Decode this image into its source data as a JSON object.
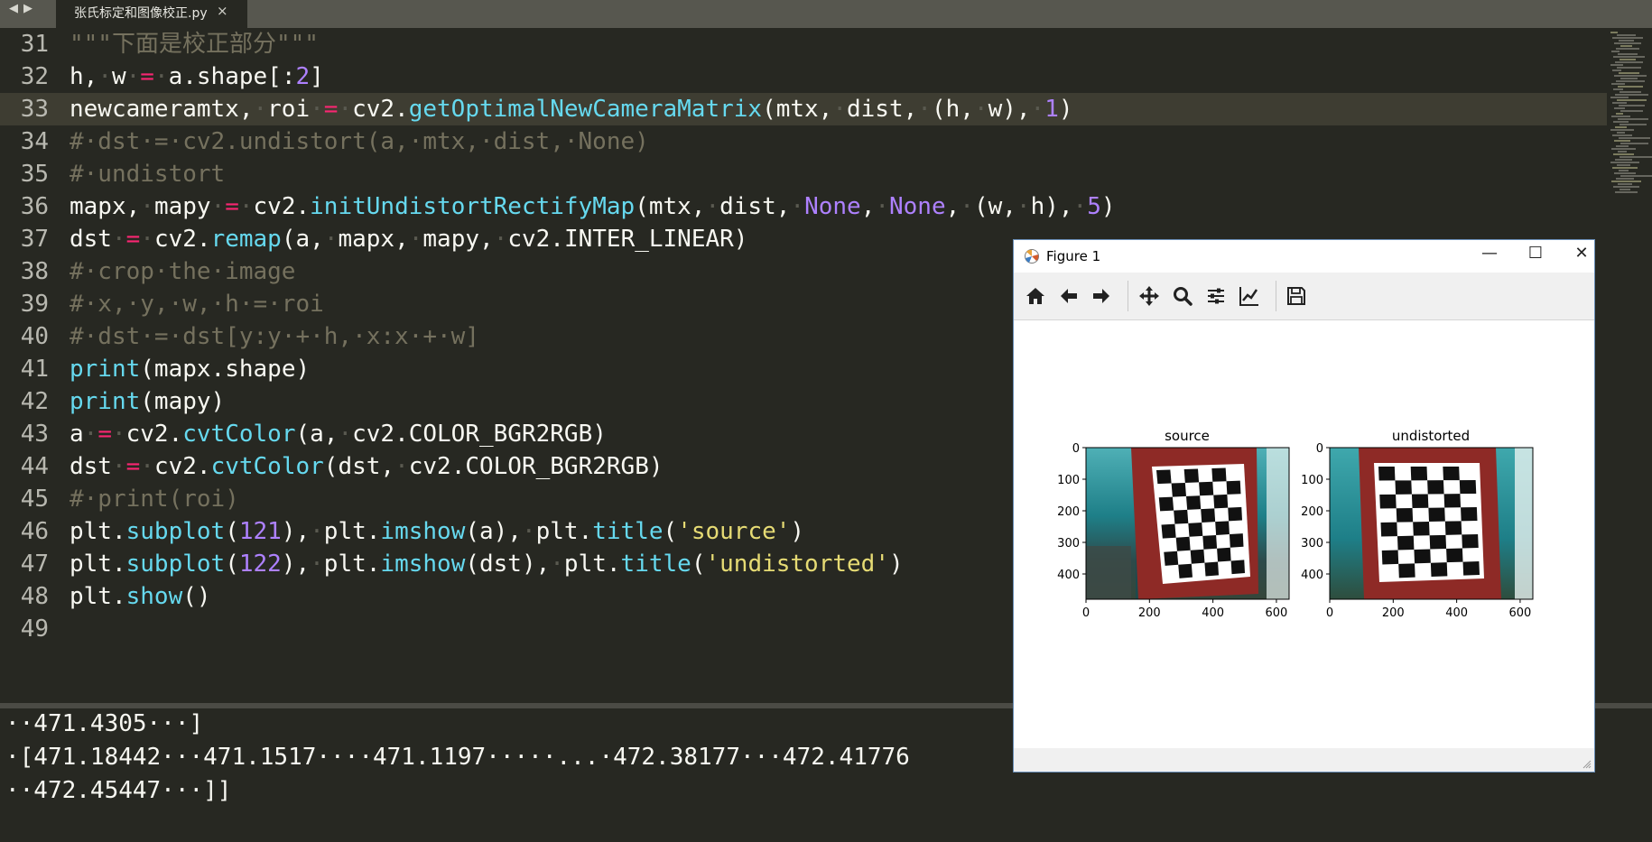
{
  "tab": {
    "title": "张氏标定和图像校正.py",
    "close": "×"
  },
  "lines": [
    {
      "num": "31",
      "tokens": [
        {
          "t": "\"\"\"下面是校正部分\"\"\"",
          "c": "c"
        }
      ]
    },
    {
      "num": "32",
      "tokens": [
        {
          "t": "h,"
        },
        {
          "t": "·",
          "c": "w"
        },
        {
          "t": "w"
        },
        {
          "t": "·",
          "c": "w"
        },
        {
          "t": "=",
          "c": "k"
        },
        {
          "t": "·",
          "c": "w"
        },
        {
          "t": "a.shape[:"
        },
        {
          "t": "2",
          "c": "n"
        },
        {
          "t": "]"
        }
      ]
    },
    {
      "num": "33",
      "current": true,
      "tokens": [
        {
          "t": "newcameramtx,"
        },
        {
          "t": "·",
          "c": "w"
        },
        {
          "t": "roi"
        },
        {
          "t": "·",
          "c": "w"
        },
        {
          "t": "=",
          "c": "k"
        },
        {
          "t": "·",
          "c": "w"
        },
        {
          "t": "cv2."
        },
        {
          "t": "getOptimalNewCameraMatrix",
          "c": "f"
        },
        {
          "t": "(mtx,"
        },
        {
          "t": "·",
          "c": "w"
        },
        {
          "t": "dist,"
        },
        {
          "t": "·",
          "c": "w"
        },
        {
          "t": "(h,"
        },
        {
          "t": "·",
          "c": "w"
        },
        {
          "t": "w),"
        },
        {
          "t": "·",
          "c": "w"
        },
        {
          "t": "1",
          "c": "n"
        },
        {
          "t": ")"
        }
      ]
    },
    {
      "num": "34",
      "tokens": [
        {
          "t": "#·dst·=·cv2.undistort(a,·mtx,·dist,·None)",
          "c": "c"
        }
      ]
    },
    {
      "num": "35",
      "tokens": [
        {
          "t": "#·undistort",
          "c": "c"
        }
      ]
    },
    {
      "num": "36",
      "tokens": [
        {
          "t": "mapx,"
        },
        {
          "t": "·",
          "c": "w"
        },
        {
          "t": "mapy"
        },
        {
          "t": "·",
          "c": "w"
        },
        {
          "t": "=",
          "c": "k"
        },
        {
          "t": "·",
          "c": "w"
        },
        {
          "t": "cv2."
        },
        {
          "t": "initUndistortRectifyMap",
          "c": "f"
        },
        {
          "t": "(mtx,"
        },
        {
          "t": "·",
          "c": "w"
        },
        {
          "t": "dist,"
        },
        {
          "t": "·",
          "c": "w"
        },
        {
          "t": "None",
          "c": "n"
        },
        {
          "t": ","
        },
        {
          "t": "·",
          "c": "w"
        },
        {
          "t": "None",
          "c": "n"
        },
        {
          "t": ","
        },
        {
          "t": "·",
          "c": "w"
        },
        {
          "t": "(w,"
        },
        {
          "t": "·",
          "c": "w"
        },
        {
          "t": "h),"
        },
        {
          "t": "·",
          "c": "w"
        },
        {
          "t": "5",
          "c": "n"
        },
        {
          "t": ")"
        }
      ]
    },
    {
      "num": "37",
      "tokens": [
        {
          "t": "dst"
        },
        {
          "t": "·",
          "c": "w"
        },
        {
          "t": "=",
          "c": "k"
        },
        {
          "t": "·",
          "c": "w"
        },
        {
          "t": "cv2."
        },
        {
          "t": "remap",
          "c": "f"
        },
        {
          "t": "(a,"
        },
        {
          "t": "·",
          "c": "w"
        },
        {
          "t": "mapx,"
        },
        {
          "t": "·",
          "c": "w"
        },
        {
          "t": "mapy,"
        },
        {
          "t": "·",
          "c": "w"
        },
        {
          "t": "cv2.INTER_LINEAR)"
        }
      ]
    },
    {
      "num": "38",
      "tokens": [
        {
          "t": "#·crop·the·image",
          "c": "c"
        }
      ]
    },
    {
      "num": "39",
      "tokens": [
        {
          "t": "#·x,·y,·w,·h·=·roi",
          "c": "c"
        }
      ]
    },
    {
      "num": "40",
      "tokens": [
        {
          "t": "#·dst·=·dst[y:y·+·h,·x:x·+·w]",
          "c": "c"
        }
      ]
    },
    {
      "num": "41",
      "tokens": [
        {
          "t": "print",
          "c": "f"
        },
        {
          "t": "(mapx.shape)"
        }
      ]
    },
    {
      "num": "42",
      "tokens": [
        {
          "t": "print",
          "c": "f"
        },
        {
          "t": "(mapy)"
        }
      ]
    },
    {
      "num": "43",
      "tokens": [
        {
          "t": "a"
        },
        {
          "t": "·",
          "c": "w"
        },
        {
          "t": "=",
          "c": "k"
        },
        {
          "t": "·",
          "c": "w"
        },
        {
          "t": "cv2."
        },
        {
          "t": "cvtColor",
          "c": "f"
        },
        {
          "t": "(a,"
        },
        {
          "t": "·",
          "c": "w"
        },
        {
          "t": "cv2.COLOR_BGR2RGB)"
        }
      ]
    },
    {
      "num": "44",
      "tokens": [
        {
          "t": "dst"
        },
        {
          "t": "·",
          "c": "w"
        },
        {
          "t": "=",
          "c": "k"
        },
        {
          "t": "·",
          "c": "w"
        },
        {
          "t": "cv2."
        },
        {
          "t": "cvtColor",
          "c": "f"
        },
        {
          "t": "(dst,"
        },
        {
          "t": "·",
          "c": "w"
        },
        {
          "t": "cv2.COLOR_BGR2RGB)"
        }
      ]
    },
    {
      "num": "45",
      "tokens": [
        {
          "t": "#·print(roi)",
          "c": "c"
        }
      ]
    },
    {
      "num": "46",
      "tokens": [
        {
          "t": "plt."
        },
        {
          "t": "subplot",
          "c": "f"
        },
        {
          "t": "("
        },
        {
          "t": "121",
          "c": "n"
        },
        {
          "t": "),"
        },
        {
          "t": "·",
          "c": "w"
        },
        {
          "t": "plt."
        },
        {
          "t": "imshow",
          "c": "f"
        },
        {
          "t": "(a),"
        },
        {
          "t": "·",
          "c": "w"
        },
        {
          "t": "plt."
        },
        {
          "t": "title",
          "c": "f"
        },
        {
          "t": "("
        },
        {
          "t": "'source'",
          "c": "s"
        },
        {
          "t": ")"
        }
      ]
    },
    {
      "num": "47",
      "tokens": [
        {
          "t": "plt."
        },
        {
          "t": "subplot",
          "c": "f"
        },
        {
          "t": "("
        },
        {
          "t": "122",
          "c": "n"
        },
        {
          "t": "),"
        },
        {
          "t": "·",
          "c": "w"
        },
        {
          "t": "plt."
        },
        {
          "t": "imshow",
          "c": "f"
        },
        {
          "t": "(dst),"
        },
        {
          "t": "·",
          "c": "w"
        },
        {
          "t": "plt."
        },
        {
          "t": "title",
          "c": "f"
        },
        {
          "t": "("
        },
        {
          "t": "'undistorted'",
          "c": "s"
        },
        {
          "t": ")"
        }
      ]
    },
    {
      "num": "48",
      "tokens": [
        {
          "t": "plt."
        },
        {
          "t": "show",
          "c": "f"
        },
        {
          "t": "()"
        }
      ]
    },
    {
      "num": "49",
      "tokens": []
    }
  ],
  "console": [
    "··471.4305···]",
    "·[471.18442···471.1517····471.1197·····...·472.38177···472.41776",
    "··472.45447···]]"
  ],
  "figure": {
    "window_title": "Figure 1",
    "controls": {
      "minimize": "—",
      "maximize": "☐",
      "close": "✕"
    },
    "toolbar_icons": [
      "home-icon",
      "back-arrow-icon",
      "forward-arrow-icon",
      "pan-icon",
      "zoom-icon",
      "subplots-config-icon",
      "edit-axis-icon",
      "save-icon"
    ],
    "plots": [
      {
        "title": "source",
        "xticks": [
          "0",
          "200",
          "400",
          "600"
        ],
        "yticks": [
          "0",
          "100",
          "200",
          "300",
          "400"
        ]
      },
      {
        "title": "undistorted",
        "xticks": [
          "0",
          "200",
          "400",
          "600"
        ],
        "yticks": [
          "0",
          "100",
          "200",
          "300",
          "400"
        ]
      }
    ]
  }
}
